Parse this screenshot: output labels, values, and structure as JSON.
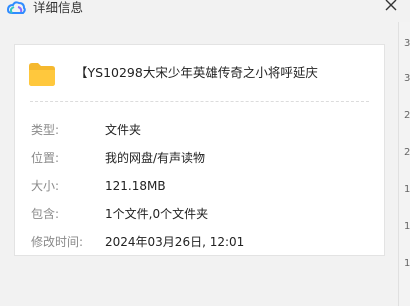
{
  "window": {
    "title": "详细信息",
    "logo_icon": "cloud-logo-icon",
    "close_icon": "close-icon"
  },
  "file": {
    "icon": "folder-icon",
    "name": "【YS10298大宋少年英雄传奇之小将呼延庆"
  },
  "details": [
    {
      "label": "类型:",
      "value": "文件夹"
    },
    {
      "label": "位置:",
      "value": "我的网盘/有声读物"
    },
    {
      "label": "大小:",
      "value": "121.18MB"
    },
    {
      "label": "包含:",
      "value": "1个文件,0个文件夹"
    },
    {
      "label": "修改时间:",
      "value": "2024年03月26日, 12:01"
    }
  ],
  "background_sliver": [
    "3",
    "3",
    "2",
    "2",
    "1",
    "1",
    "1"
  ],
  "colors": {
    "accent_folder": "#f5b82e",
    "logo_blue": "#2f8cff",
    "logo_teal": "#35c8c2",
    "logo_purple": "#8a6cff"
  }
}
